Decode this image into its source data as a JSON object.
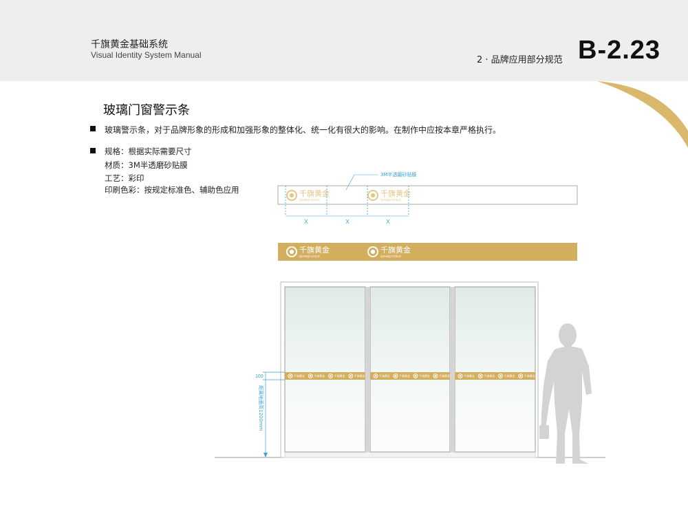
{
  "header": {
    "brand_cn": "千旗黄金基础系统",
    "brand_en": "Visual Identity System Manual",
    "section": "2 · 品牌应用部分规范",
    "page_code": "B-2.23"
  },
  "content": {
    "title": "玻璃门窗警示条",
    "description": "玻璃警示条，对于品牌形象的形成和加强形象的整体化、统一化有很大的影响。在制作中应按本章严格执行。",
    "specs": [
      "规格：根据实际需要尺寸",
      "材质：3M半透磨砂贴膜",
      "工艺：彩印",
      "印刷色彩：按规定标准色、辅助色应用"
    ]
  },
  "diagram": {
    "callout_label": "3M半透磨砂贴膜",
    "logo_cn": "千旗黄金",
    "logo_en": "QIANQI GOLD",
    "spacing_label": "X",
    "height_label": "100",
    "distance_label": "距离地面高1200mm"
  },
  "colors": {
    "gold": "#d3ae5f",
    "swirl": "#e4c786",
    "dim_blue": "#3a9fd4",
    "glass": "#e6f0ed",
    "frame": "#c7c7c7"
  }
}
